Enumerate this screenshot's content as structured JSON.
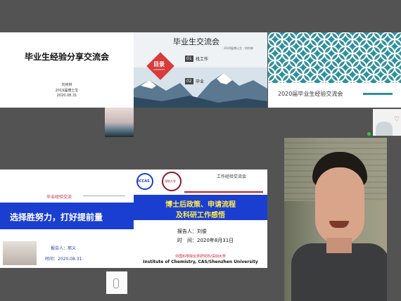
{
  "tiles": {
    "s1": {
      "title": "毕业生经验分享交流会",
      "presenter": "刘何林",
      "group": "2019届博士生",
      "date": "2020.08.31"
    },
    "s2": {
      "title": "毕业生交流会",
      "meta": "2020届博士生 · 刘何林",
      "badge": "目录",
      "badge_sub": "CONTENTS",
      "item1_num": "01",
      "item1": "找工作",
      "item2_num": "02",
      "item2": "毕业"
    },
    "s3": {
      "title": "2020届毕业生经验交流会"
    },
    "s4": {
      "top": "毕业经验交流",
      "headline": "选择胜努力，打好提前量",
      "reporter": "报告人：邢义",
      "time": "时间：2020.08.31"
    },
    "s5": {
      "corner": "工作经验交流会",
      "logo1": "ICCAS",
      "logo2": "深圳大学",
      "line1": "博士后政策、申请流程",
      "line2": "及科研工作感悟",
      "reporter": "报告人：刘俊",
      "time": "时　间：2020年8月31日",
      "inst_cn": "中国科学院化学研究所/深圳大学",
      "inst_en": "Institute of Chemistry, CAS/Shenzhen University"
    }
  },
  "colors": {
    "bg": "#535353",
    "blue": "#1a3fd0",
    "red": "#c4192a",
    "teal": "#2f8f9c"
  }
}
